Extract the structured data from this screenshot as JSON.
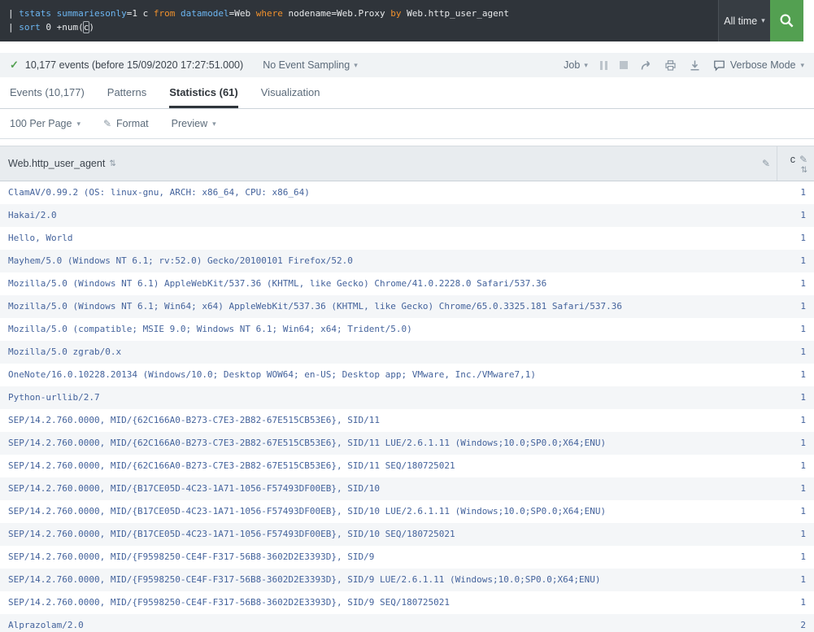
{
  "colors": {
    "accent_green": "#53a051",
    "command_blue": "#6cb6f2",
    "keyword_orange": "#f0912d",
    "link_blue": "#44639c"
  },
  "search": {
    "time_range_label": "All time",
    "lines": [
      [
        {
          "text": "| ",
          "type": "plain"
        },
        {
          "text": "tstats",
          "type": "command"
        },
        {
          "text": " ",
          "type": "plain"
        },
        {
          "text": "summariesonly",
          "type": "command"
        },
        {
          "text": "=1 c ",
          "type": "plain"
        },
        {
          "text": "from",
          "type": "keyword"
        },
        {
          "text": " ",
          "type": "plain"
        },
        {
          "text": "datamodel",
          "type": "command"
        },
        {
          "text": "=Web ",
          "type": "plain"
        },
        {
          "text": "where",
          "type": "keyword"
        },
        {
          "text": " nodename=Web.Proxy ",
          "type": "plain"
        },
        {
          "text": "by",
          "type": "keyword"
        },
        {
          "text": " Web.http_user_agent",
          "type": "plain"
        }
      ],
      [
        {
          "text": "| ",
          "type": "plain"
        },
        {
          "text": "sort",
          "type": "command"
        },
        {
          "text": " 0 +num(",
          "type": "plain"
        },
        {
          "text": "c",
          "type": "cursor"
        },
        {
          "text": ")",
          "type": "plain"
        }
      ]
    ]
  },
  "info_bar": {
    "events_summary": "10,177 events (before 15/09/2020 17:27:51.000)",
    "sampling_label": "No Event Sampling",
    "job_label": "Job",
    "verbose_label": "Verbose Mode"
  },
  "tabs": [
    {
      "label": "Events (10,177)",
      "active": false
    },
    {
      "label": "Patterns",
      "active": false
    },
    {
      "label": "Statistics (61)",
      "active": true
    },
    {
      "label": "Visualization",
      "active": false
    }
  ],
  "toolbar": {
    "per_page_label": "100 Per Page",
    "format_label": "Format",
    "preview_label": "Preview"
  },
  "table": {
    "columns": [
      "Web.http_user_agent",
      "c"
    ],
    "rows": [
      [
        "ClamAV/0.99.2 (OS: linux-gnu, ARCH: x86_64, CPU: x86_64)",
        "1"
      ],
      [
        "Hakai/2.0",
        "1"
      ],
      [
        "Hello, World",
        "1"
      ],
      [
        "Mayhem/5.0 (Windows NT 6.1; rv:52.0) Gecko/20100101 Firefox/52.0",
        "1"
      ],
      [
        "Mozilla/5.0 (Windows NT 6.1) AppleWebKit/537.36 (KHTML, like Gecko) Chrome/41.0.2228.0 Safari/537.36",
        "1"
      ],
      [
        "Mozilla/5.0 (Windows NT 6.1; Win64; x64) AppleWebKit/537.36 (KHTML, like Gecko) Chrome/65.0.3325.181 Safari/537.36",
        "1"
      ],
      [
        "Mozilla/5.0 (compatible; MSIE 9.0; Windows NT 6.1; Win64; x64; Trident/5.0)",
        "1"
      ],
      [
        "Mozilla/5.0 zgrab/0.x",
        "1"
      ],
      [
        "OneNote/16.0.10228.20134 (Windows/10.0; Desktop WOW64; en-US; Desktop app; VMware, Inc./VMware7,1)",
        "1"
      ],
      [
        "Python-urllib/2.7",
        "1"
      ],
      [
        "SEP/14.2.760.0000, MID/{62C166A0-B273-C7E3-2B82-67E515CB53E6}, SID/11",
        "1"
      ],
      [
        "SEP/14.2.760.0000, MID/{62C166A0-B273-C7E3-2B82-67E515CB53E6}, SID/11 LUE/2.6.1.11 (Windows;10.0;SP0.0;X64;ENU)",
        "1"
      ],
      [
        "SEP/14.2.760.0000, MID/{62C166A0-B273-C7E3-2B82-67E515CB53E6}, SID/11 SEQ/180725021",
        "1"
      ],
      [
        "SEP/14.2.760.0000, MID/{B17CE05D-4C23-1A71-1056-F57493DF00EB}, SID/10",
        "1"
      ],
      [
        "SEP/14.2.760.0000, MID/{B17CE05D-4C23-1A71-1056-F57493DF00EB}, SID/10 LUE/2.6.1.11 (Windows;10.0;SP0.0;X64;ENU)",
        "1"
      ],
      [
        "SEP/14.2.760.0000, MID/{B17CE05D-4C23-1A71-1056-F57493DF00EB}, SID/10 SEQ/180725021",
        "1"
      ],
      [
        "SEP/14.2.760.0000, MID/{F9598250-CE4F-F317-56B8-3602D2E3393D}, SID/9",
        "1"
      ],
      [
        "SEP/14.2.760.0000, MID/{F9598250-CE4F-F317-56B8-3602D2E3393D}, SID/9 LUE/2.6.1.11 (Windows;10.0;SP0.0;X64;ENU)",
        "1"
      ],
      [
        "SEP/14.2.760.0000, MID/{F9598250-CE4F-F317-56B8-3602D2E3393D}, SID/9 SEQ/180725021",
        "1"
      ],
      [
        "Alprazolam/2.0",
        "2"
      ]
    ]
  }
}
